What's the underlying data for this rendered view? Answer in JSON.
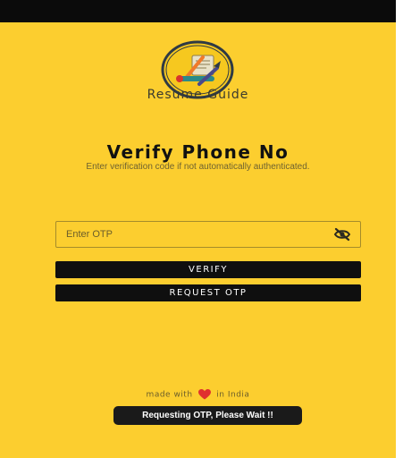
{
  "app": {
    "name": "Resume Guide"
  },
  "verify": {
    "title": "Verify Phone No",
    "subtitle": "Enter verification code if not automatically authenticated."
  },
  "otp": {
    "placeholder": "Enter OTP",
    "value": ""
  },
  "buttons": {
    "verify_label": "VERIFY",
    "request_label": "REQUEST OTP"
  },
  "footer": {
    "made_with": "made with",
    "in_india": "in India"
  },
  "toast": {
    "message": "Requesting OTP, Please Wait !!"
  },
  "icons": {
    "logo": "resume-guide-logo",
    "visibility": "eye-off-icon",
    "heart": "heart-icon"
  },
  "colors": {
    "background": "#fcce2f",
    "button": "#0f0f0f",
    "status_bar": "#0b0b0b",
    "heart": "#e0312f"
  }
}
